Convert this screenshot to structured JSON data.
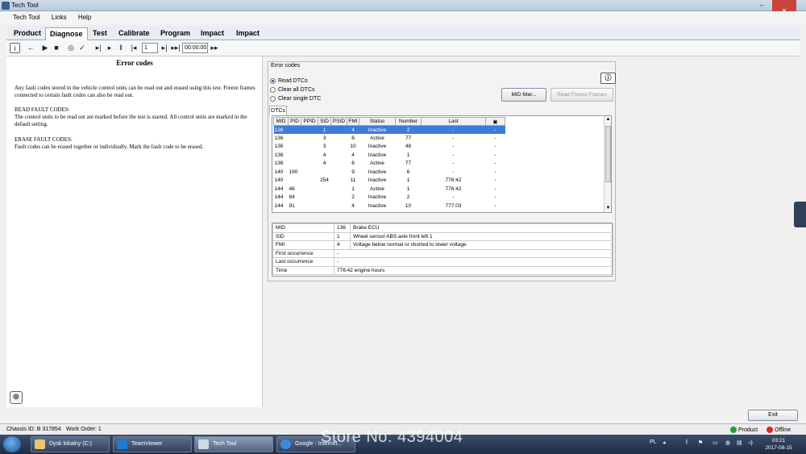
{
  "window": {
    "title": "Tech Tool",
    "controls": {
      "minimize": "–",
      "maximize": "□",
      "close": "✕"
    }
  },
  "menu": [
    "Tech Tool",
    "Links",
    "Help"
  ],
  "nav_tabs": [
    "Product",
    "Diagnose",
    "Test",
    "Calibrate",
    "Program",
    "Impact",
    "Impact"
  ],
  "toolbar": {
    "frame_value": "1",
    "time_value": "00:00:00"
  },
  "left_panel": {
    "title": "Error codes",
    "intro": "Any fault codes stored in the vehicle control units can be read out and erased using this test. Freeze frames connected to certain fault codes can also be read out.",
    "read_heading": "READ FAULT CODES:",
    "read_text": "The control units to be read out are marked before the test is started. All control units are marked in the default setting.",
    "erase_heading": "ERASE FAULT CODES:",
    "erase_text": "Fault codes can be erased together or individually. Mark the fault code to be erased."
  },
  "error_codes": {
    "group_title": "Error codes",
    "radios": [
      {
        "label": "Read DTCs",
        "selected": true
      },
      {
        "label": "Clear all DTCs",
        "selected": false
      },
      {
        "label": "Clear single DTC",
        "selected": false
      }
    ],
    "mid_filter_button": "MID filter...",
    "freeze_frames_button": "Read Freeze Frames",
    "dtc_tab": "DTCs",
    "columns": [
      "MID",
      "PID",
      "PPID",
      "SID",
      "PSID",
      "FMI",
      "Status",
      "Number",
      "Last"
    ],
    "rows": [
      [
        "136",
        "",
        "",
        "1",
        "",
        "4",
        "Inactive",
        "2",
        "-",
        "-"
      ],
      [
        "136",
        "",
        "",
        "3",
        "",
        "6",
        "Active",
        "77",
        "-",
        "-"
      ],
      [
        "136",
        "",
        "",
        "3",
        "",
        "10",
        "Inactive",
        "48",
        "-",
        "-"
      ],
      [
        "136",
        "",
        "",
        "4",
        "",
        "4",
        "Inactive",
        "1",
        "-",
        "-"
      ],
      [
        "136",
        "",
        "",
        "4",
        "",
        "6",
        "Active",
        "77",
        "-",
        "-"
      ],
      [
        "140",
        "190",
        "",
        "",
        "",
        "9",
        "Inactive",
        "6",
        "-",
        "-"
      ],
      [
        "140",
        "",
        "",
        "254",
        "",
        "11",
        "Inactive",
        "1",
        "776:42",
        "-"
      ],
      [
        "144",
        "46",
        "",
        "",
        "",
        "1",
        "Active",
        "1",
        "776:42",
        "-"
      ],
      [
        "144",
        "84",
        "",
        "",
        "",
        "2",
        "Inactive",
        "2",
        "-",
        "-"
      ],
      [
        "144",
        "91",
        "",
        "",
        "",
        "4",
        "Inactive",
        "10",
        "777:03",
        "-"
      ]
    ],
    "selected_row": 0,
    "details": [
      {
        "key": "MID",
        "code": "136",
        "desc": "Brake ECU"
      },
      {
        "key": "SID",
        "code": "1",
        "desc": "Wheel sensor ABS axle front left 1"
      },
      {
        "key": "FMI",
        "code": "4",
        "desc": "Voltage below normal or shorted to lower voltage"
      },
      {
        "key": "First occurrence",
        "code": "-",
        "desc": ""
      },
      {
        "key": "Last occurrence",
        "code": "-",
        "desc": ""
      },
      {
        "key": "Time",
        "code": "776:42 engine hours",
        "desc": ""
      }
    ]
  },
  "exit_button": "Exit",
  "status": {
    "chassis": "Chassis ID: B 317854",
    "work_order": "Work Order: 1",
    "product": "Product",
    "offline": "Offline"
  },
  "taskbar": {
    "items": [
      "Dysk lokalny (C:)",
      "TeamViewer",
      "Tech Tool",
      "Google - Internet..."
    ],
    "active": 2,
    "lang": "PL",
    "time": "03:21",
    "date": "2017-08-15"
  },
  "watermark": "Store No: 4394004"
}
